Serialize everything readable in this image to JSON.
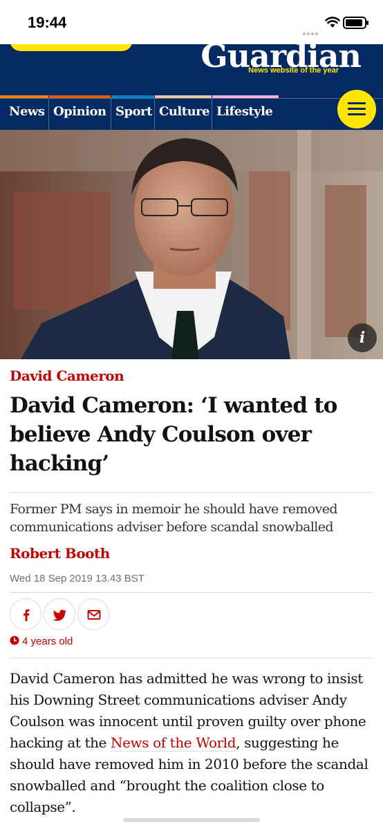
{
  "status_bar": {
    "time": "19:44"
  },
  "header": {
    "logo": "Guardian",
    "logo_tagline": "News website of the year",
    "nav": [
      {
        "label": "News",
        "stripe": "#ff7f0f"
      },
      {
        "label": "Opinion",
        "stripe": "#e05e00"
      },
      {
        "label": "Sport",
        "stripe": "#0084c6"
      },
      {
        "label": "Culture",
        "stripe": "#eacca0"
      },
      {
        "label": "Lifestyle",
        "stripe": "#ffabdb"
      }
    ],
    "menu_icon": "hamburger-menu-icon"
  },
  "hero": {
    "info_label": "i"
  },
  "article": {
    "kicker": "David Cameron",
    "headline": "David Cameron: ‘I wanted to believe Andy Coulson over hacking’",
    "standfirst": "Former PM says in memoir he should have removed communications adviser before scandal snowballed",
    "byline": "Robert Booth",
    "dateline": "Wed 18 Sep 2019 13.43 BST",
    "share_icons": [
      "facebook-icon",
      "twitter-icon",
      "email-icon"
    ],
    "age": "4 years old",
    "body_before_link": "David Cameron has admitted he was wrong to insist his Downing Street communications adviser Andy Coulson was innocent until proven guilty over phone hacking at the ",
    "body_link": "News of the World",
    "body_after_link": ", suggesting he should have removed him in 2010 before the scandal snowballed and “brought the coalition close to collapse”."
  },
  "colors": {
    "brand_blue": "#052962",
    "news_red": "#c70000",
    "highlight_yellow": "#ffe500"
  }
}
